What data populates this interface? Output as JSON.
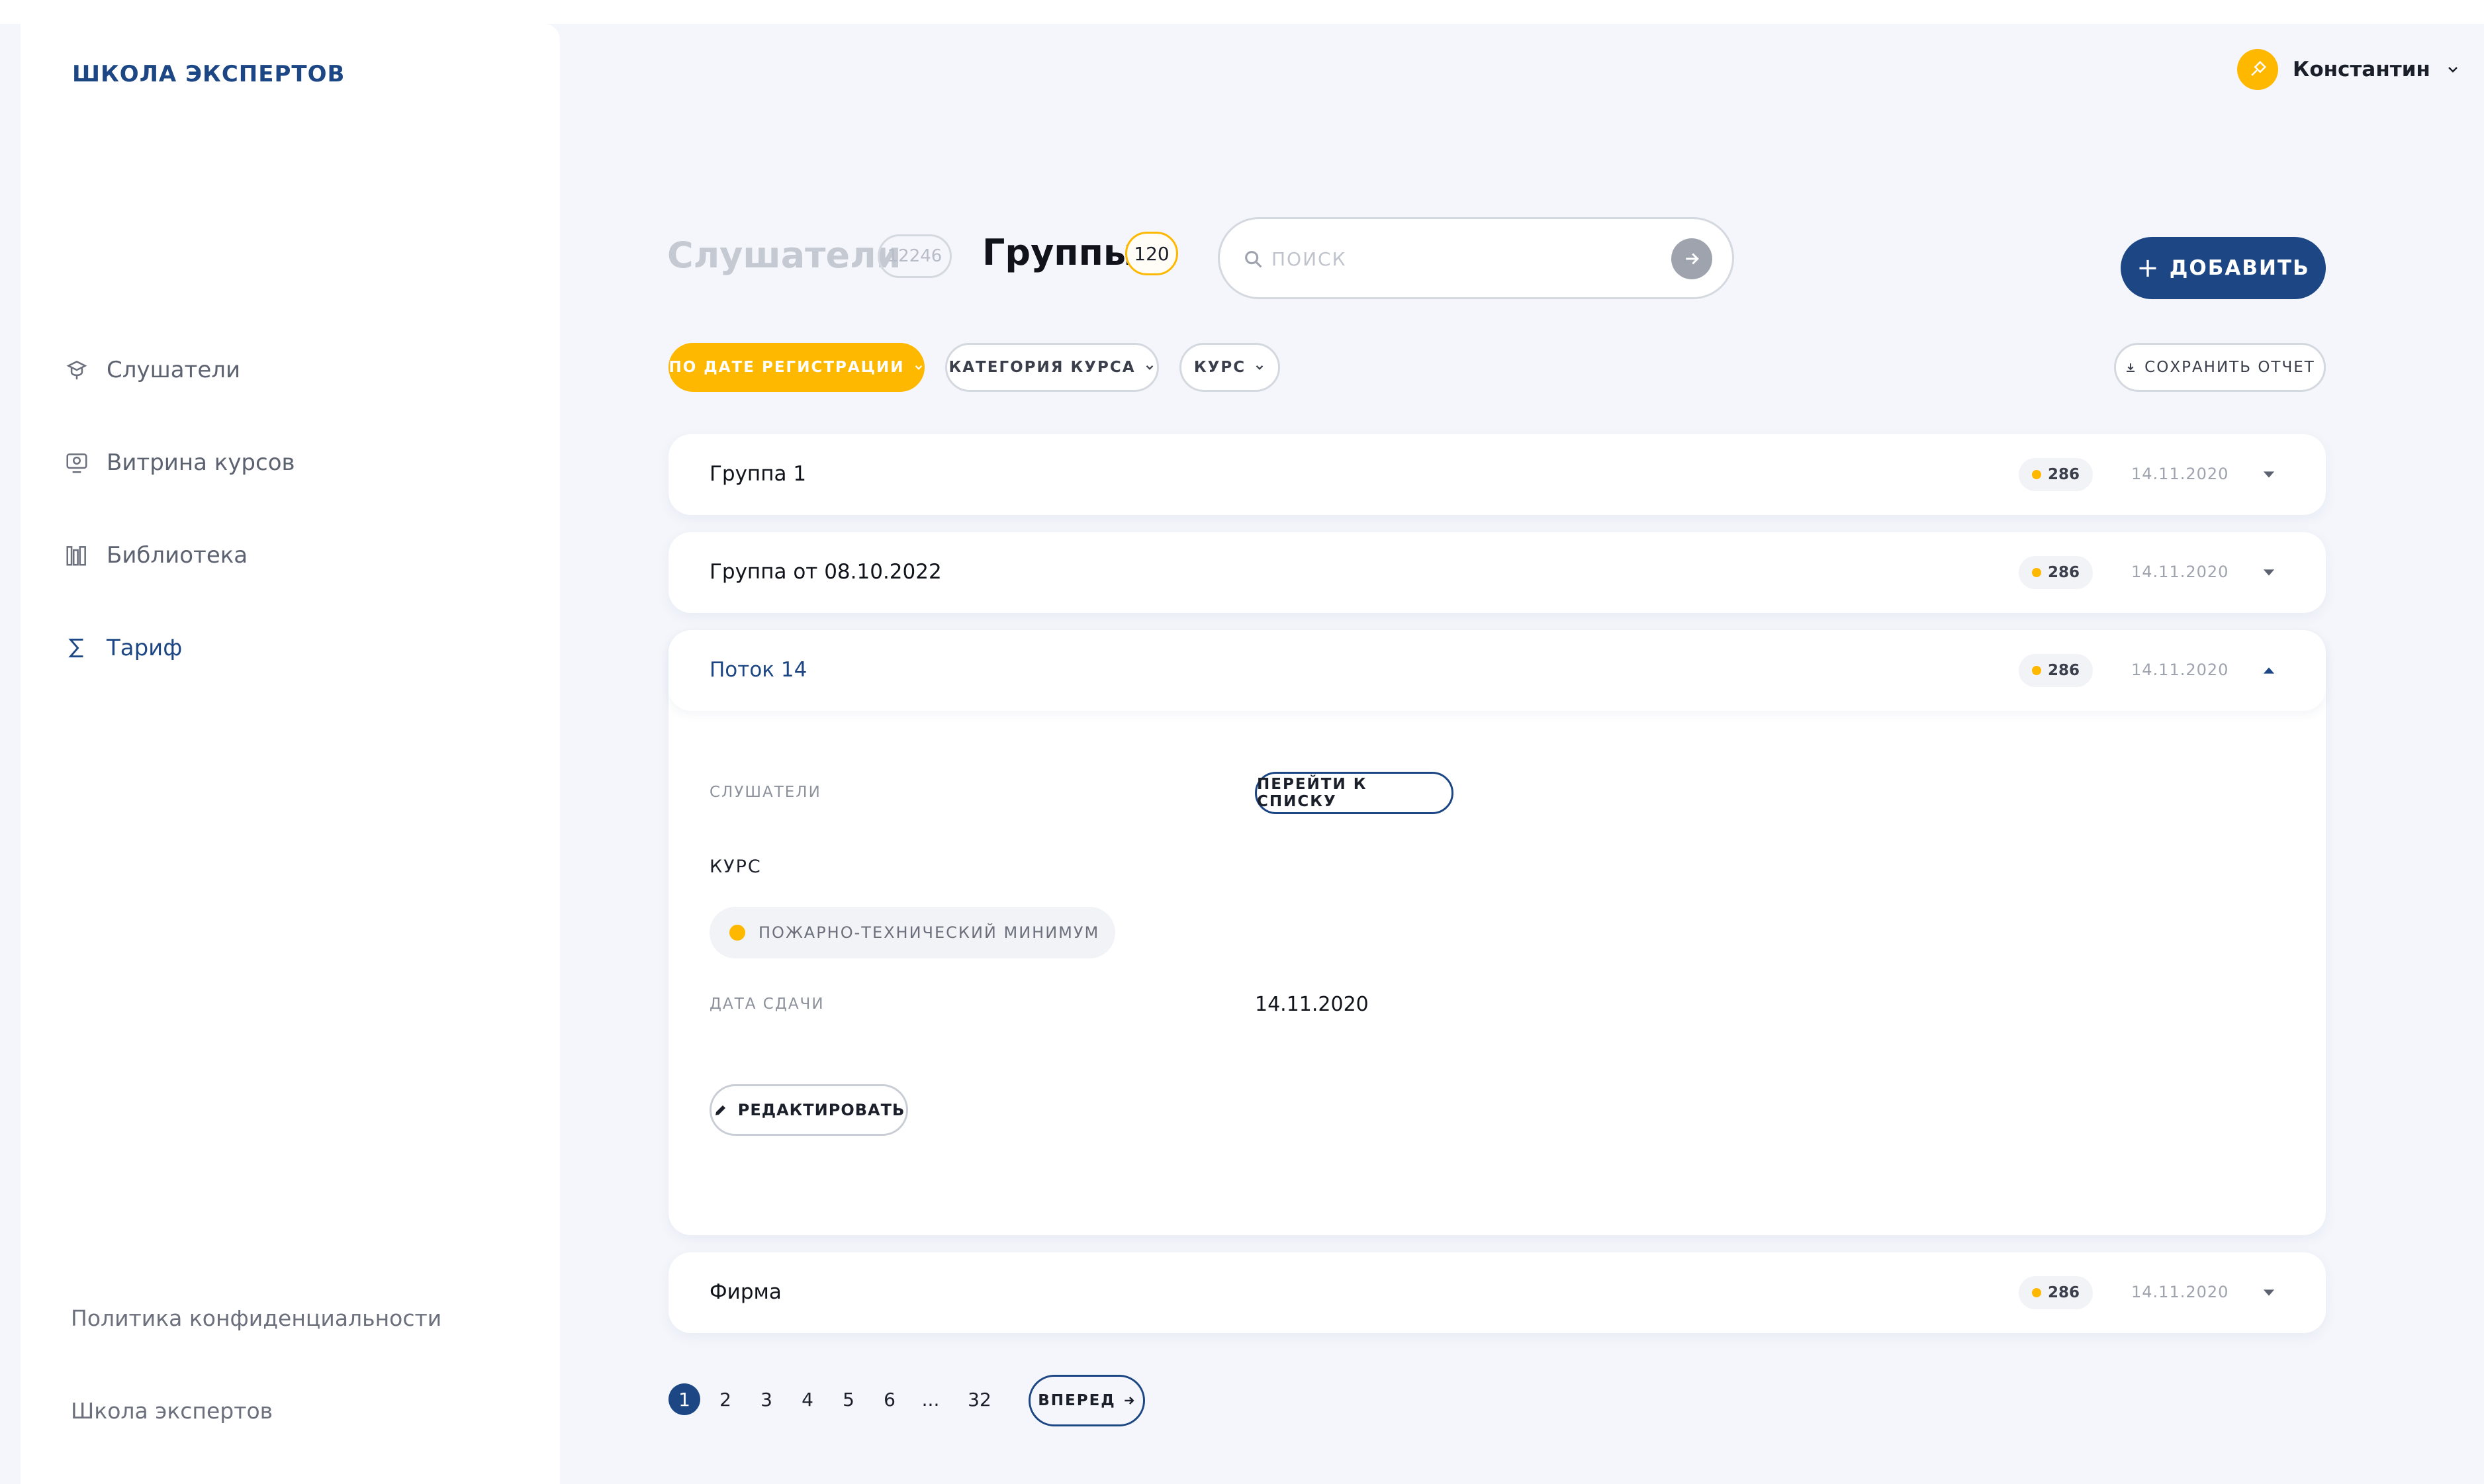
{
  "app": {
    "logo": "ШКОЛА ЭКСПЕРТОВ"
  },
  "colors": {
    "brand": "#1d4784",
    "accent": "#ffb800",
    "background": "#f4f6fb"
  },
  "sidebar": {
    "items": [
      {
        "label": "Слушатели",
        "icon": "students-icon",
        "active": false
      },
      {
        "label": "Витрина курсов",
        "icon": "course-showcase-icon",
        "active": false
      },
      {
        "label": "Библиотека",
        "icon": "library-icon",
        "active": false
      },
      {
        "label": "Тариф",
        "icon": "sigma-icon",
        "active": true
      }
    ],
    "footer": {
      "privacy": "Политика конфиденциальности",
      "school": "Школа экспертов"
    }
  },
  "user": {
    "name": "Константин",
    "icon": "user-avatar-icon"
  },
  "tabs": {
    "listeners": {
      "label": "Слушатели",
      "count": "12246"
    },
    "groups": {
      "label": "Группы",
      "count": "120"
    }
  },
  "search": {
    "placeholder": "ПОИСК",
    "value": ""
  },
  "add_button": {
    "icon": "+",
    "label": "ДОБАВИТЬ"
  },
  "filters": {
    "by_date": "ПО ДАТЕ РЕГИСТРАЦИИ",
    "category": "КАТЕГОРИЯ КУРСА",
    "course": "КУРС",
    "save_report": "СОХРАНИТЬ ОТЧЕТ"
  },
  "groups": [
    {
      "title": "Группа 1",
      "count": "286",
      "date": "14.11.2020",
      "expanded": false
    },
    {
      "title": "Группа от 08.10.2022",
      "count": "286",
      "date": "14.11.2020",
      "expanded": false
    },
    {
      "title": "Поток 14",
      "count": "286",
      "date": "14.11.2020",
      "expanded": true
    },
    {
      "title": "Фирма",
      "count": "286",
      "date": "14.11.2020",
      "expanded": false
    }
  ],
  "expanded_details": {
    "listeners_label": "СЛУШАТЕЛИ",
    "go_to_list": "ПЕРЕЙТИ К СПИСКУ",
    "course_label": "КУРС",
    "course_name": "ПОЖАРНО-ТЕХНИЧЕСКИЙ МИНИМУМ",
    "due_date_label": "ДАТА СДАЧИ",
    "due_date_value": "14.11.2020",
    "edit_label": "РЕДАКТИРОВАТЬ"
  },
  "pagination": {
    "pages": [
      "1",
      "2",
      "3",
      "4",
      "5",
      "6",
      "...",
      "32"
    ],
    "current": "1",
    "next": "ВПЕРЕД"
  }
}
